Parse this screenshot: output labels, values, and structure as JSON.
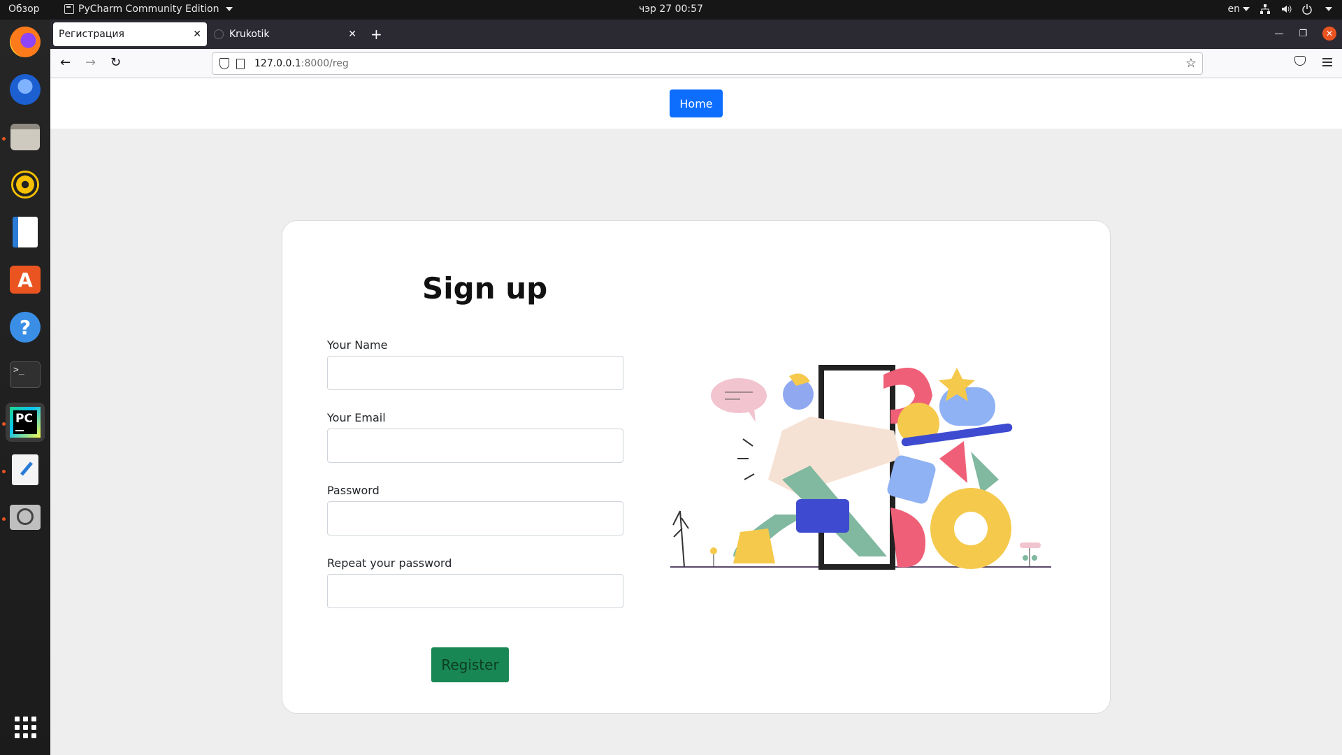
{
  "topbar": {
    "activities": "Обзор",
    "app_name": "PyCharm Community Edition",
    "clock": "чэр 27  00:57",
    "keyboard_layout": "en"
  },
  "dock": {
    "items": [
      "firefox-icon",
      "thunderbird-icon",
      "files-icon",
      "rhythmbox-icon",
      "libreoffice-writer-icon",
      "software-store-icon",
      "help-icon",
      "terminal-icon",
      "pycharm-icon",
      "text-editor-icon",
      "search-tool-icon",
      "app-grid-icon"
    ]
  },
  "browser": {
    "tabs": [
      {
        "label": "Регистрация",
        "active": true
      },
      {
        "label": "Krukotik",
        "active": false
      }
    ],
    "url_host": "127.0.0.1",
    "url_path": ":8000/reg"
  },
  "page": {
    "home_label": "Home",
    "title": "Sign up",
    "fields": [
      {
        "label": "Your Name",
        "value": ""
      },
      {
        "label": "Your Email",
        "value": ""
      },
      {
        "label": "Password",
        "value": ""
      },
      {
        "label": "Repeat your password",
        "value": ""
      }
    ],
    "register_label": "Register"
  },
  "colors": {
    "primary": "#0d6efd",
    "success": "#198754",
    "page_bg": "#eeeeee",
    "ubuntu_accent": "#e95420"
  }
}
